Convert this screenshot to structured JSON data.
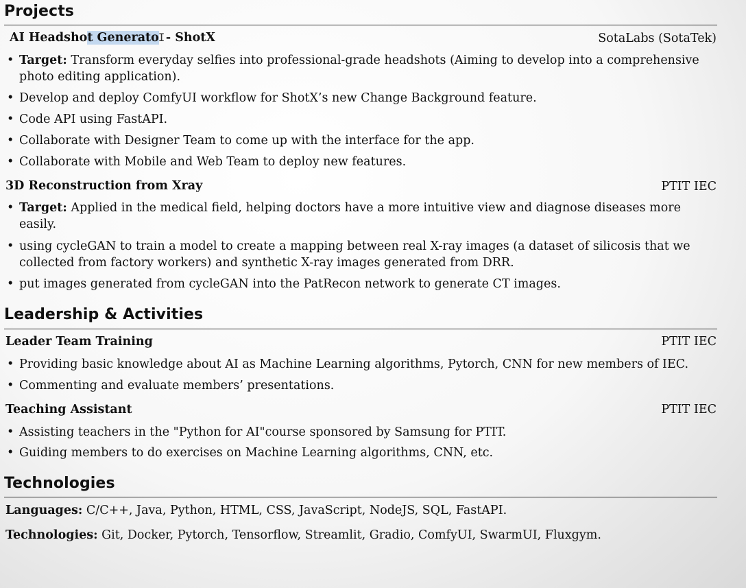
{
  "sections": {
    "projects": {
      "title": "Projects",
      "entries": [
        {
          "title_pre": "AI Headsho",
          "title_highlight": "t Generato",
          "title_post": " - ShotX",
          "org": "SotaLabs (SotaTek)",
          "bullets": [
            {
              "label": "Target:",
              "text": " Transform everyday selfies into professional-grade headshots (Aiming to develop into a comprehensive photo editing application)."
            },
            {
              "label": "",
              "text": "Develop and deploy ComfyUI workflow for ShotX’s new Change Background feature."
            },
            {
              "label": "",
              "text": "Code API using FastAPI."
            },
            {
              "label": "",
              "text": "Collaborate with Designer Team to come up with the interface for the app."
            },
            {
              "label": "",
              "text": "Collaborate with Mobile and Web Team to deploy new features."
            }
          ]
        },
        {
          "title": "3D Reconstruction from Xray",
          "org": "PTIT IEC",
          "bullets": [
            {
              "label": "Target:",
              "text": " Applied in the medical field, helping doctors have a more intuitive view and diagnose diseases more easily."
            },
            {
              "label": "",
              "text": "using cycleGAN to train a model to create a mapping between real X-ray images (a dataset of silicosis that we collected from factory workers) and synthetic X-ray images generated from DRR."
            },
            {
              "label": "",
              "text": "put images generated from cycleGAN into the PatRecon network to generate CT images."
            }
          ]
        }
      ]
    },
    "leadership": {
      "title": "Leadership & Activities",
      "entries": [
        {
          "title": "Leader Team Training",
          "org": "PTIT IEC",
          "bullets": [
            {
              "text": "Providing basic knowledge about AI as Machine Learning algorithms, Pytorch, CNN for new members of IEC."
            },
            {
              "text": "Commenting and evaluate members’ presentations."
            }
          ]
        },
        {
          "title": "Teaching Assistant",
          "org": "PTIT IEC",
          "bullets": [
            {
              "text": "Assisting teachers in the \"Python for AI\"course sponsored by Samsung for PTIT."
            },
            {
              "text": "Guiding members to do exercises on Machine Learning algorithms, CNN, etc."
            }
          ]
        }
      ]
    },
    "technologies": {
      "title": "Technologies",
      "languages_label": "Languages:",
      "languages_value": " C/C++, Java, Python, HTML, CSS, JavaScript, NodeJS, SQL, FastAPI.",
      "technologies_label": "Technologies:",
      "technologies_value": " Git, Docker, Pytorch, Tensorflow, Streamlit, Gradio, ComfyUI, SwarmUI, Fluxgym."
    }
  },
  "bullet_glyph": "•",
  "caret_glyph": "I",
  "colors": {
    "text_highlight": "#c3d8ef",
    "rule": "#333333"
  }
}
